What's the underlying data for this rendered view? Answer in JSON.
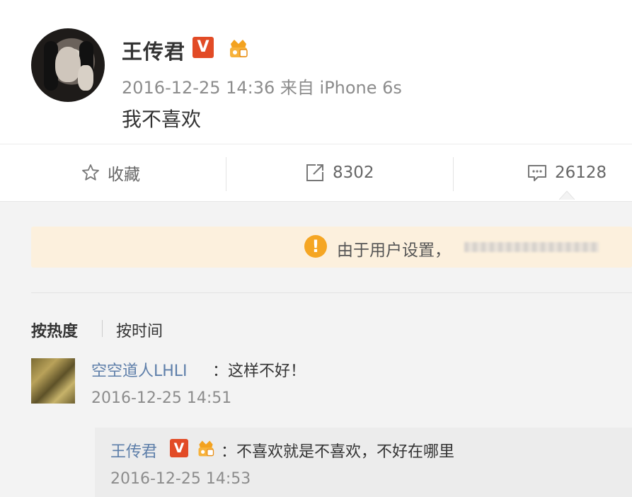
{
  "post": {
    "author": "王传君",
    "verified_badge": "V",
    "timestamp": "2016-12-25 14:36 来自 iPhone 6s",
    "text": "我不喜欢"
  },
  "actions": {
    "favorite_label": "收藏",
    "repost_count": "8302",
    "comment_count": "26128"
  },
  "notice": {
    "icon_text": "!",
    "text": "由于用户设置，"
  },
  "sort": {
    "by_hot": "按热度",
    "by_time": "按时间"
  },
  "comment": {
    "user": "空空道人LHLI",
    "text": "：这样不好！",
    "timestamp": "2016-12-25 14:51"
  },
  "reply": {
    "user": "王传君",
    "verified_badge": "V",
    "text": "：不喜欢就是不喜欢，不好在哪里",
    "timestamp": "2016-12-25 14:53"
  },
  "colors": {
    "link_blue": "#5d7ea9",
    "verified_red": "#e24b26",
    "notice_bg": "#fcf0dd",
    "notice_icon": "#f5a623"
  }
}
